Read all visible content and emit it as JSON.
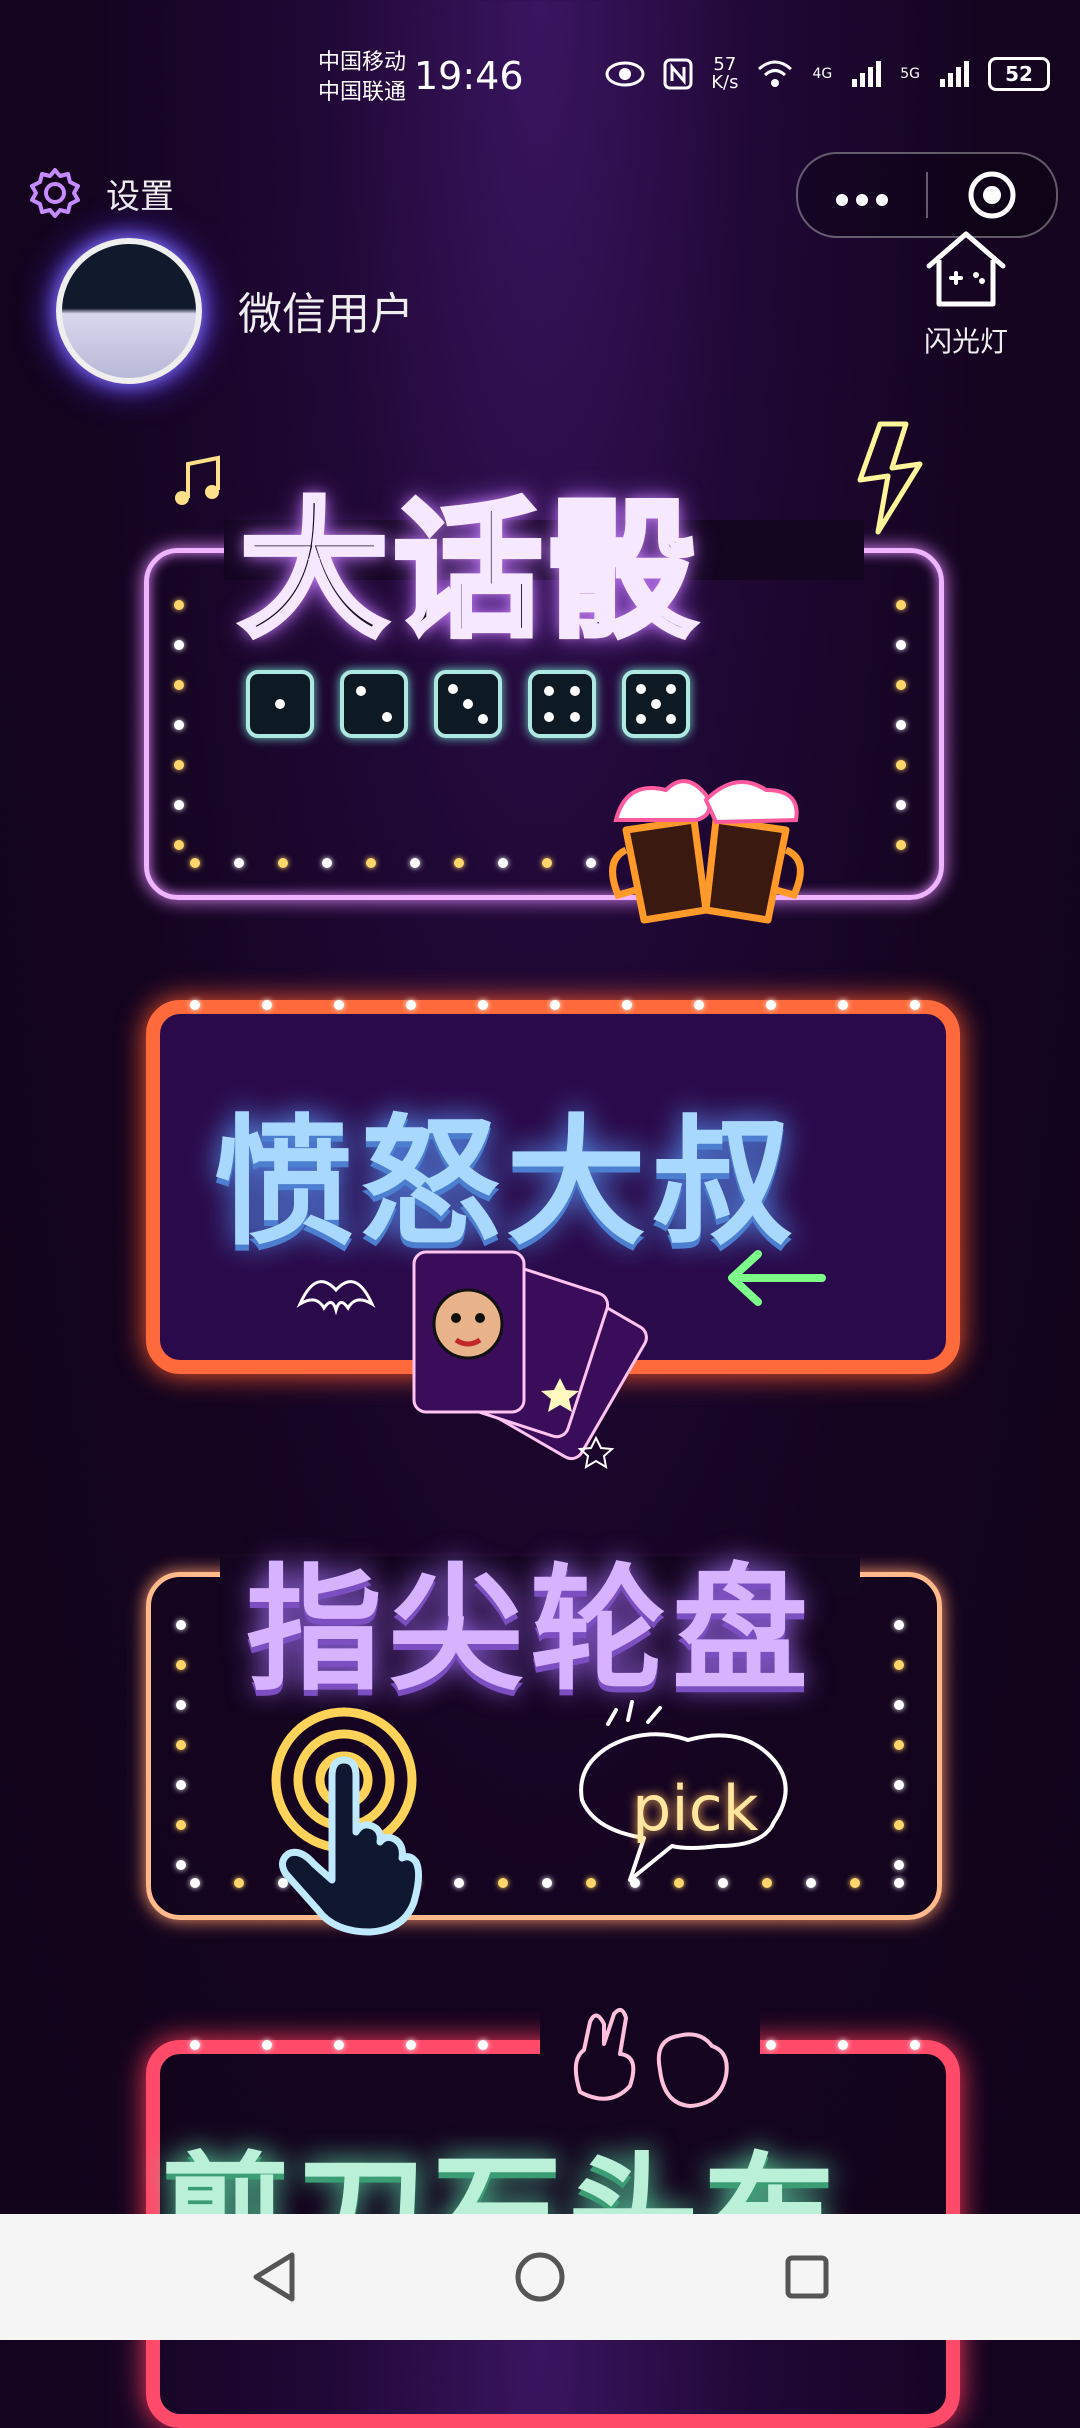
{
  "status_bar": {
    "carrier_1": "中国移动",
    "carrier_2": "中国联通",
    "time": "19:46",
    "network_speed": "57\nK/s",
    "net_4g": "4G",
    "net_5g": "5G",
    "battery": "52"
  },
  "header": {
    "settings_label": "设置",
    "username": "微信用户",
    "flashlight_label": "闪光灯"
  },
  "games": [
    {
      "title": "大话骰"
    },
    {
      "title": "愤怒大叔"
    },
    {
      "title": "指尖轮盘",
      "bubble_text": "pick"
    },
    {
      "title": "剪刀石头布"
    }
  ],
  "colors": {
    "card1_border": "#f0b4ff",
    "card2_border": "#ff6a3d",
    "card3_border": "#ffb98a",
    "card4_border": "#ff4a6a"
  },
  "icons": {
    "settings": "gear-icon",
    "more": "more-icon",
    "close": "target-icon",
    "flashlight": "house-icon",
    "back": "back-triangle-icon",
    "home": "home-circle-icon",
    "recent": "recent-square-icon"
  }
}
